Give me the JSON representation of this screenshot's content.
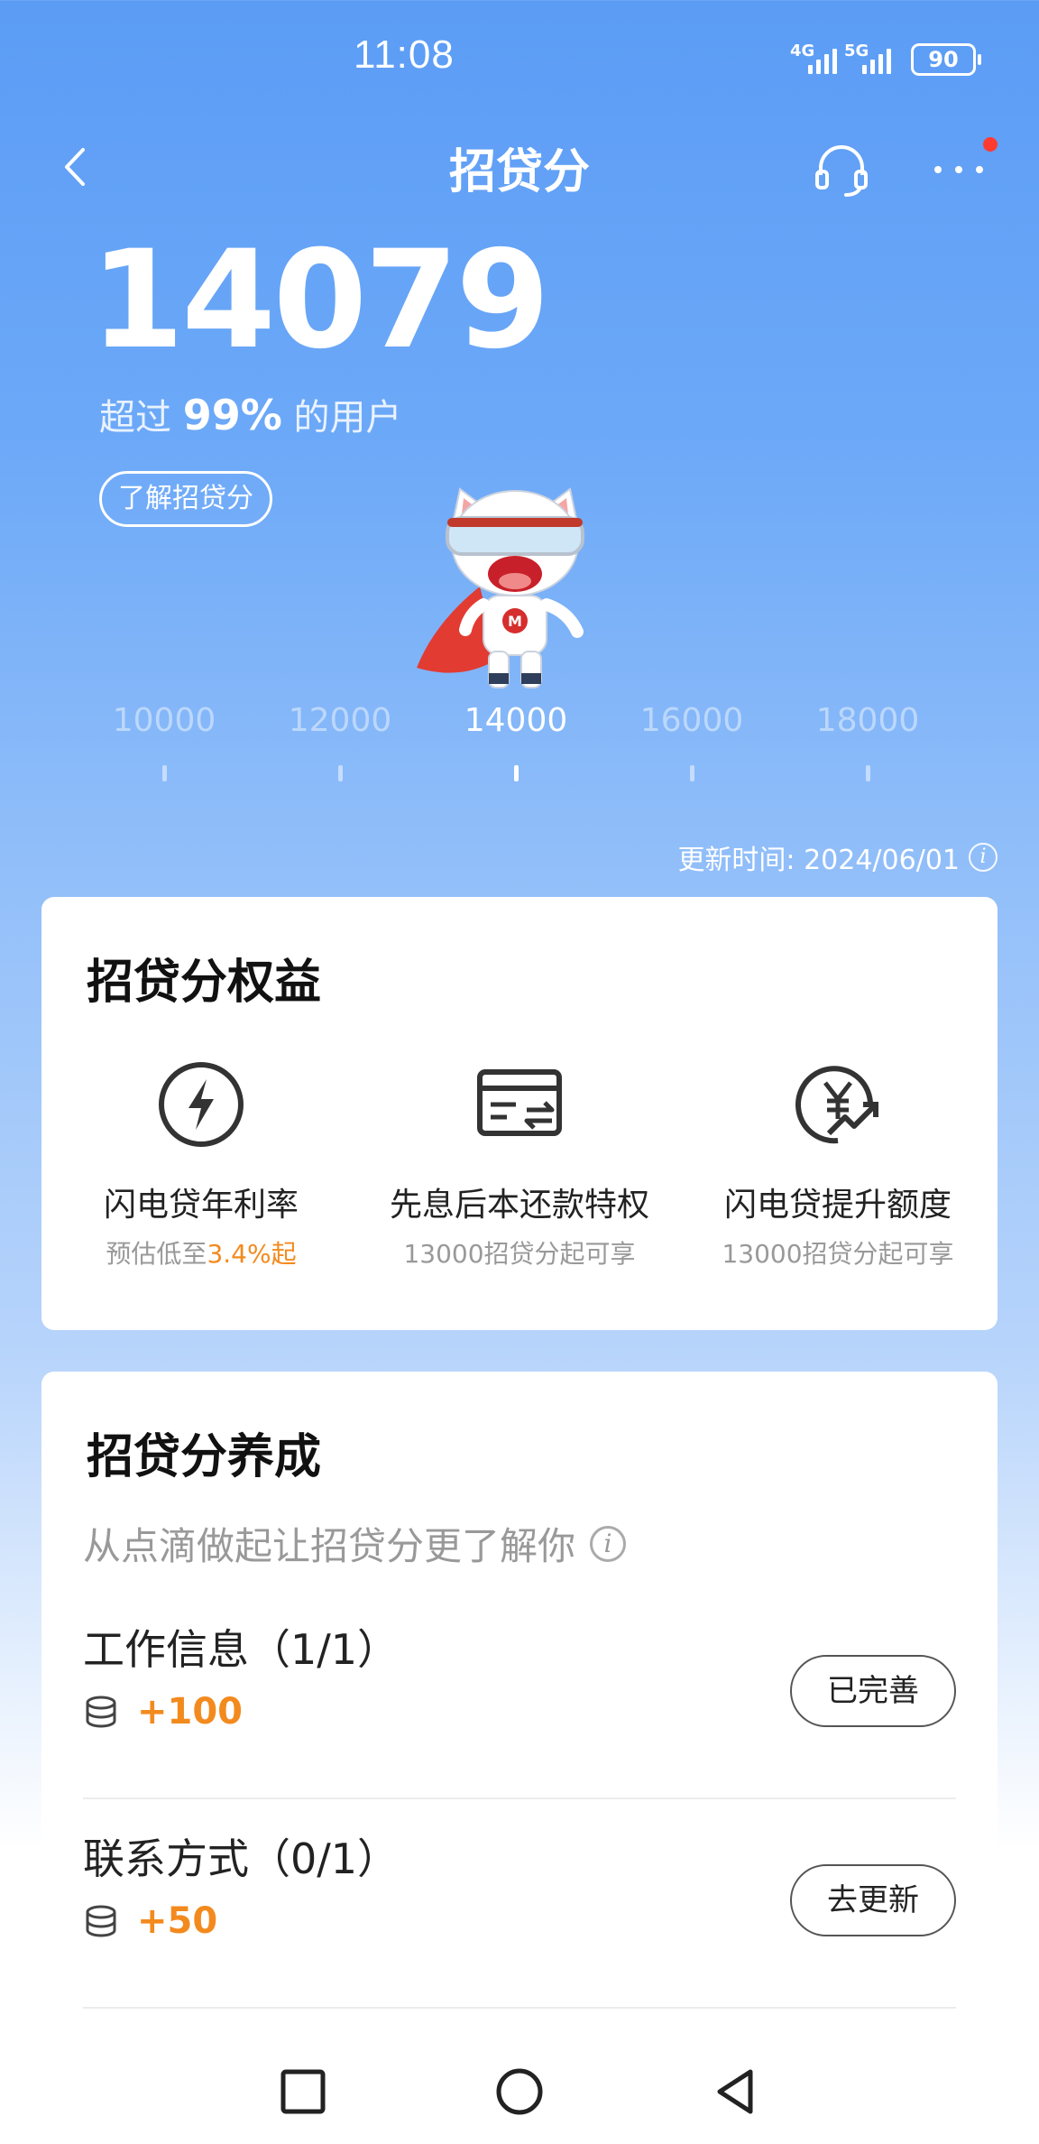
{
  "status_bar": {
    "time": "11:08",
    "network_1": "4G",
    "network_2": "5G",
    "battery": "90"
  },
  "header": {
    "title": "招贷分",
    "back_icon": "chevron-left-icon",
    "service_icon": "headset-icon",
    "more_icon": "more-dots-icon",
    "notification_dot_color": "#ff3b30"
  },
  "score": {
    "value": "14079",
    "percentile_prefix": "超过",
    "percentile_value": "99%",
    "percentile_suffix": "的用户",
    "learn_more": "了解招贷分"
  },
  "scale": {
    "labels": [
      "10000",
      "12000",
      "14000",
      "16000",
      "18000"
    ],
    "active_index": 2
  },
  "update": {
    "text": "更新时间: 2024/06/01",
    "info_icon": "info-icon"
  },
  "benefits": {
    "title": "招贷分权益",
    "items": [
      {
        "name": "闪电贷年利率",
        "sub_prefix": "预估低至",
        "sub_highlight": "3.4%起",
        "icon": "lightning-icon"
      },
      {
        "name": "先息后本还款特权",
        "sub": "13000招贷分起可享",
        "icon": "card-exchange-icon"
      },
      {
        "name": "闪电贷提升额度",
        "sub": "13000招贷分起可享",
        "icon": "yen-growth-icon"
      }
    ]
  },
  "grow": {
    "title": "招贷分养成",
    "subtitle": "从点滴做起让招贷分更了解你",
    "tasks": [
      {
        "name": "工作信息（1/1）",
        "points": "+100",
        "button": "已完善"
      },
      {
        "name": "联系方式（0/1）",
        "points": "+50",
        "button": "去更新"
      }
    ]
  },
  "colors": {
    "accent_orange": "#f38a1e",
    "header_blue": "#5b9cf5"
  }
}
